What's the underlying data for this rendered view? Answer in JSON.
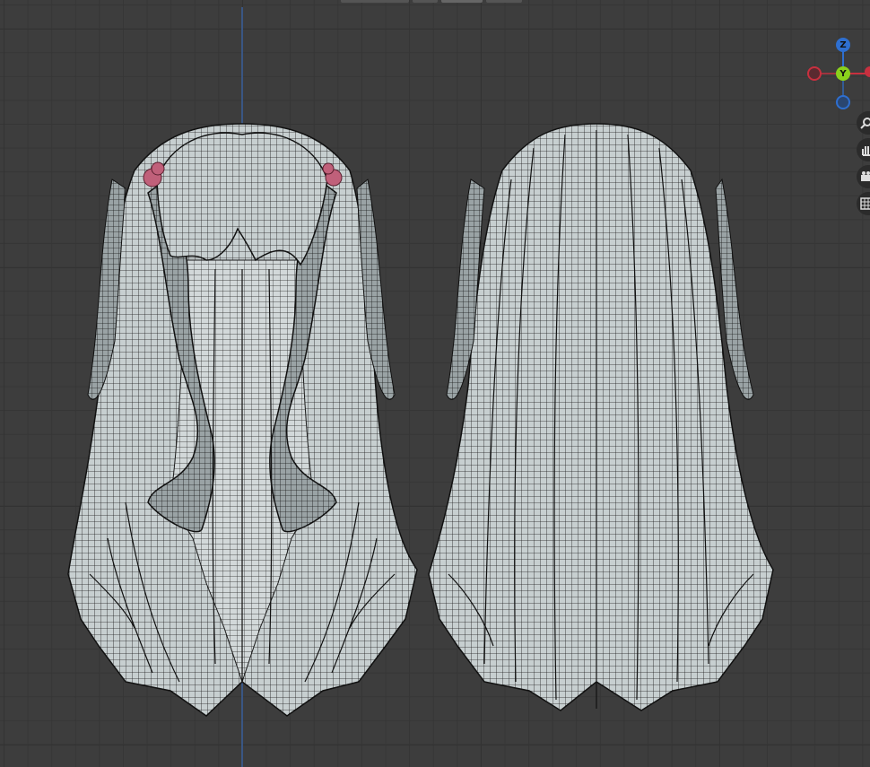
{
  "viewport": {
    "grid_visible": true,
    "view_axis": "front",
    "background_color": "#3d3d3d"
  },
  "gizmo": {
    "z_label": "Z",
    "y_label": "Y",
    "colors": {
      "z": "#2e6fd0",
      "y": "#8ad11c",
      "x": "#c8303f"
    }
  },
  "nav_buttons": [
    {
      "icon": "zoom-icon"
    },
    {
      "icon": "hand-pan-icon"
    },
    {
      "icon": "camera-icon"
    },
    {
      "icon": "grid-view-icon"
    }
  ],
  "selection_color": "#c0607a"
}
